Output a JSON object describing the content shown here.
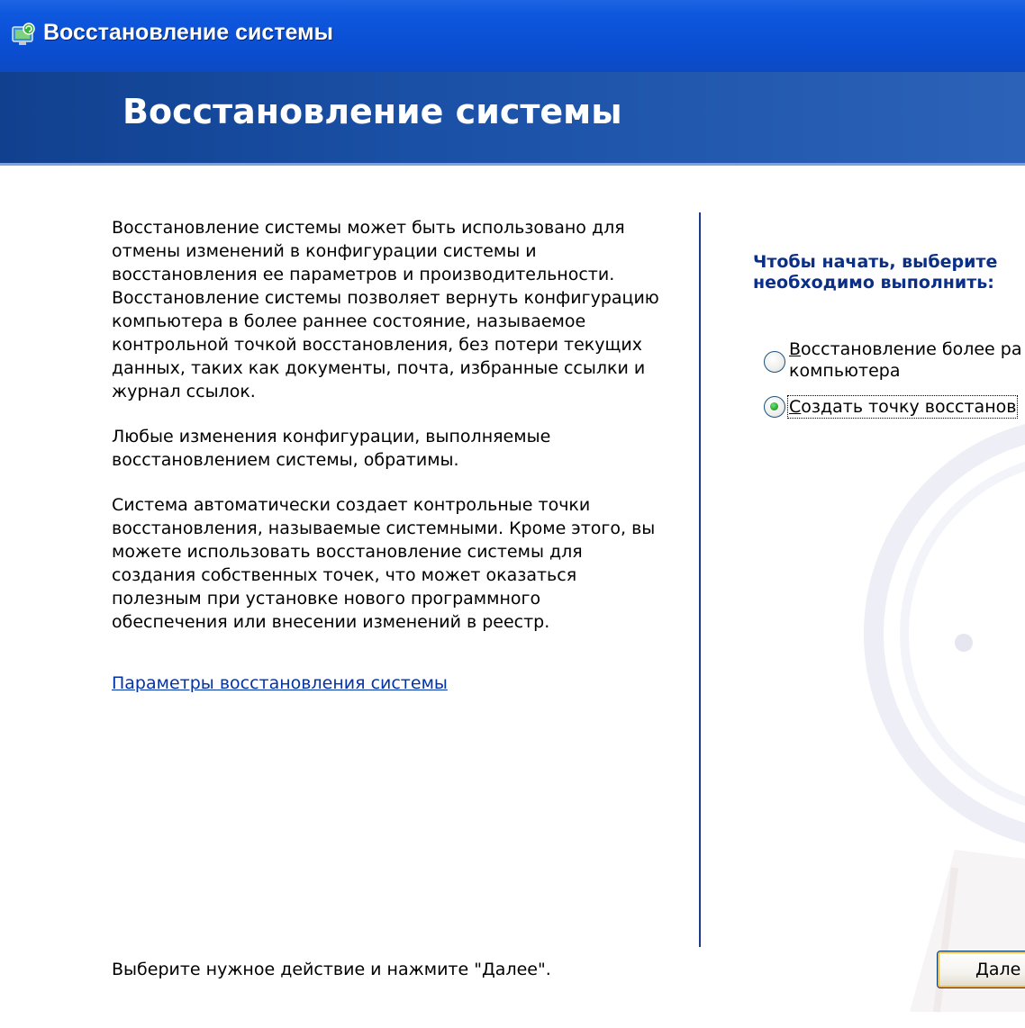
{
  "window": {
    "title": "Восстановление системы",
    "icon": "system-restore-icon"
  },
  "header": {
    "title": "Восстановление системы"
  },
  "left": {
    "paragraphs": [
      "Восстановление системы может быть использовано для отмены изменений в конфигурации системы и восстановления ее параметров и производительности. Восстановление системы позволяет вернуть конфигурацию компьютера в более раннее состояние, называемое контрольной точкой восстановления, без потери текущих данных, таких как документы, почта, избранные ссылки и журнал ссылок.",
      "Любые изменения конфигурации, выполняемые восстановлением системы, обратимы.",
      "Система автоматически создает контрольные точки восстановления, называемые системными. Кроме этого, вы можете использовать восстановление системы для создания собственных точек, что может оказаться полезным при установке нового программного обеспечения или внесении изменений в реестр."
    ],
    "settings_link": "Параметры восстановления системы",
    "footer_hint": "Выберите нужное действие и нажмите \"Далее\"."
  },
  "right": {
    "heading_line1": "Чтобы начать, выберите",
    "heading_line2": "необходимо выполнить:",
    "options": [
      {
        "accel": "В",
        "rest_line1": "осстановление более ра",
        "line2": "компьютера",
        "selected": false
      },
      {
        "accel": "С",
        "rest_line1": "оздать точку восстанов",
        "selected": true
      }
    ],
    "next_button": {
      "accel": "Д",
      "rest": "але"
    }
  },
  "colors": {
    "titlebar": "#0a4fd4",
    "header_band": "#1b52a8",
    "heading_text": "#0b2f86",
    "link": "#0033aa",
    "divider": "#1c3d8a"
  }
}
